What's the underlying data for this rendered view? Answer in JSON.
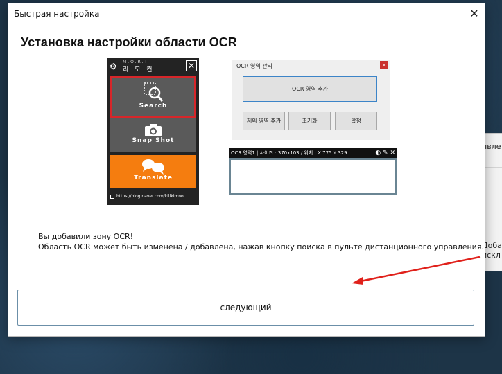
{
  "background_window": {
    "row1": "пвле",
    "row2": "Доба",
    "row3": "искл"
  },
  "dialog": {
    "title": "Быстрая настройка",
    "close_glyph": "✕",
    "heading": "Установка настройки области OCR"
  },
  "remote": {
    "logo_top": "M.O.R.T",
    "logo_name": "리 모 컨",
    "close_glyph": "✕",
    "search_label": "Search",
    "snapshot_label": "Snap Shot",
    "translate_label": "Translate",
    "url": "https://blog.naver.com/killkimno",
    "highlight_color": "#d7262a",
    "translate_color": "#f57d0f"
  },
  "ocr_manager": {
    "title": "OCR 영역 관리",
    "close_glyph": "x",
    "add_label": "OCR 영역 추가",
    "exclude_label": "제외 영역 추가",
    "reset_label": "초기화",
    "confirm_label": "확정"
  },
  "ocr_area": {
    "bar_text": "OCR 영역1 | 사이즈 : 370x103 / 위치 : X 775 Y 329",
    "tools": "◐ ✎ ✕"
  },
  "message": {
    "line1": "Вы добавили зону OCR!",
    "line2": "Область OCR может быть изменена / добавлена, нажав кнопку поиска в пульте дистанционного управления."
  },
  "next_button": {
    "label": "следующий"
  },
  "annotation_color": "#e0211b"
}
